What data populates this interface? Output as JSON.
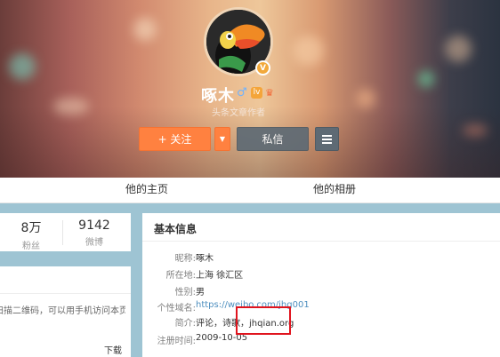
{
  "profile": {
    "name": "啄木",
    "subtitle": "头条文章作者",
    "verified_badge": "V",
    "gender_icon": "male-icon",
    "level_icon": "level-icon",
    "level_text": "lv",
    "vip_icon": "vip-icon"
  },
  "actions": {
    "follow_label": "+ 关注",
    "follow_dropdown": "▼",
    "message_label": "私信"
  },
  "nav": {
    "tabs": [
      {
        "label": "他的主页"
      },
      {
        "label": "他的相册"
      }
    ]
  },
  "stats": {
    "fans_value": "8万",
    "fans_label": "粉丝",
    "weibo_value": "9142",
    "weibo_label": "微博"
  },
  "qr_card": {
    "text": "扫描二维码，可以用手机访问本页",
    "download_label": "下载"
  },
  "basic_info": {
    "title": "基本信息",
    "rows": [
      {
        "key": "昵称:",
        "value": "啄木"
      },
      {
        "key": "所在地:",
        "value": "上海 徐汇区"
      },
      {
        "key": "性别:",
        "value": "男"
      },
      {
        "key": "个性域名:",
        "value": "https://weibo.com/jhg001"
      },
      {
        "key": "简介:",
        "value": "评论，诗歌，jhqian.org"
      },
      {
        "key": "注册时间:",
        "value": "2009-10-05"
      }
    ]
  },
  "colors": {
    "follow_orange": "#ff8140",
    "highlight_red": "#e0141e",
    "link_blue": "#4e8fbf",
    "page_bg": "#9ec4d3"
  }
}
